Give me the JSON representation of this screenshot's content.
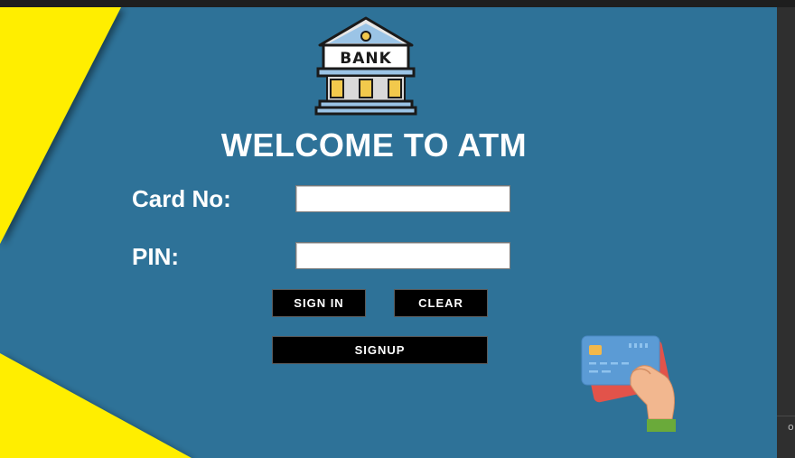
{
  "app": {
    "logo_text": "BANK",
    "title": "WELCOME TO ATM"
  },
  "form": {
    "card_label": "Card No:",
    "card_value": "",
    "pin_label": "PIN:",
    "pin_value": ""
  },
  "buttons": {
    "sign_in": "SIGN IN",
    "clear": "CLEAR",
    "signup": "SIGNUP"
  },
  "edge": {
    "partial_char": "o"
  },
  "icons": [
    "bank-logo-icon",
    "credit-card-hand-icon"
  ],
  "colors": {
    "background": "#2e7298",
    "accent_yellow": "#ffee00",
    "button_bg": "#000000",
    "text": "#ffffff"
  }
}
